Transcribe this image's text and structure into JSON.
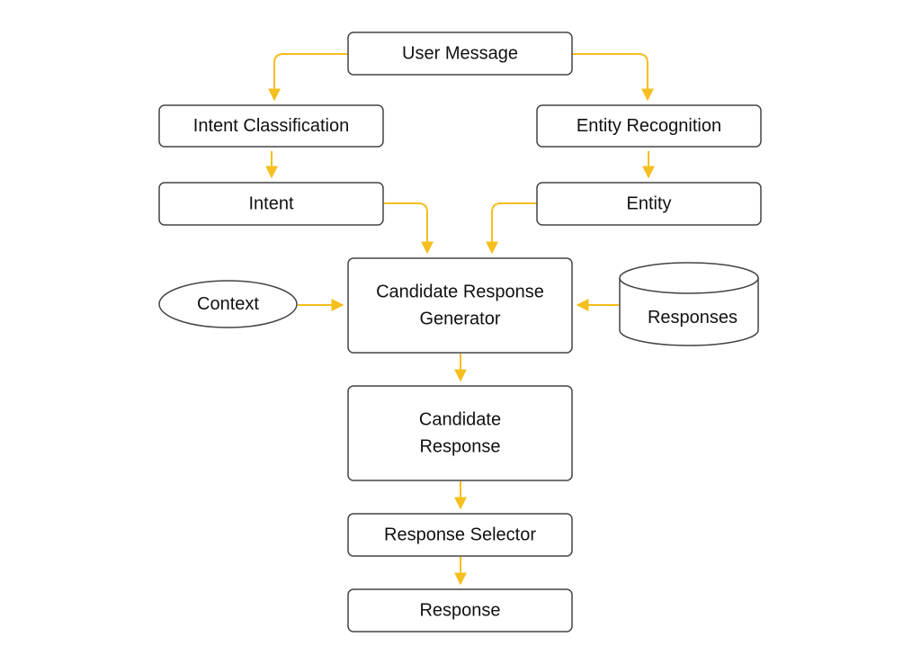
{
  "colors": {
    "edge": "#F5BF1E",
    "node_stroke": "#444444",
    "text": "#111111",
    "background": "#FFFFFF"
  },
  "nodes": {
    "user_message": {
      "lines": [
        "User Message"
      ],
      "shape": "rounded-rect"
    },
    "intent_classification": {
      "lines": [
        "Intent Classification"
      ],
      "shape": "rounded-rect"
    },
    "entity_recognition": {
      "lines": [
        "Entity Recognition"
      ],
      "shape": "rounded-rect"
    },
    "intent": {
      "lines": [
        "Intent"
      ],
      "shape": "rounded-rect"
    },
    "entity": {
      "lines": [
        "Entity"
      ],
      "shape": "rounded-rect"
    },
    "context": {
      "lines": [
        "Context"
      ],
      "shape": "ellipse"
    },
    "candidate_response_generator": {
      "lines": [
        "Candidate Response",
        "Generator"
      ],
      "shape": "rounded-rect"
    },
    "responses": {
      "lines": [
        "Responses"
      ],
      "shape": "cylinder"
    },
    "candidate_response": {
      "lines": [
        "Candidate",
        "Response"
      ],
      "shape": "rounded-rect"
    },
    "response_selector": {
      "lines": [
        "Response Selector"
      ],
      "shape": "rounded-rect"
    },
    "response": {
      "lines": [
        "Response"
      ],
      "shape": "rounded-rect"
    }
  },
  "edges": [
    {
      "from": "user_message",
      "to": "intent_classification"
    },
    {
      "from": "user_message",
      "to": "entity_recognition"
    },
    {
      "from": "intent_classification",
      "to": "intent"
    },
    {
      "from": "entity_recognition",
      "to": "entity"
    },
    {
      "from": "intent",
      "to": "candidate_response_generator"
    },
    {
      "from": "entity",
      "to": "candidate_response_generator"
    },
    {
      "from": "context",
      "to": "candidate_response_generator"
    },
    {
      "from": "responses",
      "to": "candidate_response_generator"
    },
    {
      "from": "candidate_response_generator",
      "to": "candidate_response"
    },
    {
      "from": "candidate_response",
      "to": "response_selector"
    },
    {
      "from": "response_selector",
      "to": "response"
    }
  ]
}
